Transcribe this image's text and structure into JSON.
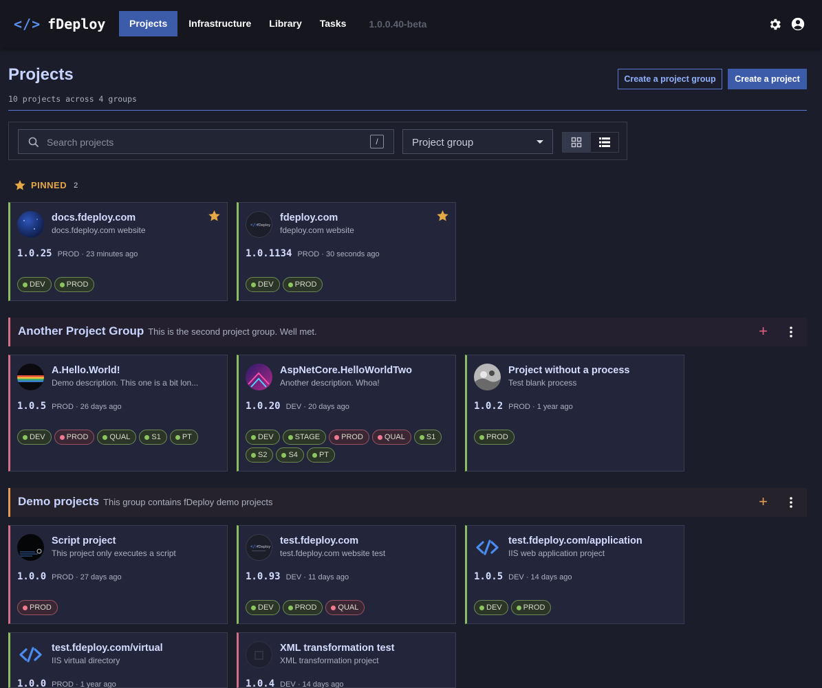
{
  "app": {
    "brand_code": "</>",
    "brand_name": "fDeploy",
    "version": "1.0.0.40-beta"
  },
  "nav": {
    "projects": "Projects",
    "infrastructure": "Infrastructure",
    "library": "Library",
    "tasks": "Tasks"
  },
  "header": {
    "title": "Projects",
    "subtitle": "10 projects across 4 groups",
    "create_group": "Create a project group",
    "create_project": "Create a project"
  },
  "filter": {
    "search_placeholder": "Search projects",
    "shortcut": "/",
    "group_select": "Project group"
  },
  "pinned": {
    "label": "PINNED",
    "count": "2"
  },
  "groups": [
    {
      "name": "Another Project Group",
      "description": "This is the second project group. Well met."
    },
    {
      "name": "Demo projects",
      "description": "This group contains fDeploy demo projects"
    }
  ],
  "colors": {
    "accent": "#3c5ba8",
    "success": "#8cc460",
    "danger": "#f07a92",
    "pinned": "#e6a845"
  },
  "cards": [
    {
      "title": "docs.fdeploy.com",
      "desc": "docs.fdeploy.com website",
      "version": "1.0.25",
      "meta": "PROD · 23 minutes ago",
      "tags": [
        "DEV",
        "PROD"
      ]
    },
    {
      "title": "fdeploy.com",
      "desc": "fdeploy.com website",
      "version": "1.0.1134",
      "meta": "PROD · 30 seconds ago",
      "tags": [
        "DEV",
        "PROD"
      ]
    },
    {
      "title": "A.Hello.World!",
      "desc": "Demo description. This one is a bit lon...",
      "version": "1.0.5",
      "meta": "PROD · 26 days ago",
      "tags": [
        "DEV",
        "PROD",
        "QUAL",
        "S1",
        "PT"
      ]
    },
    {
      "title": "AspNetCore.HelloWorldTwo",
      "desc": "Another description. Whoa!",
      "version": "1.0.20",
      "meta": "DEV · 20 days ago",
      "tags": [
        "DEV",
        "STAGE",
        "PROD",
        "QUAL",
        "S1",
        "S2",
        "S4",
        "PT"
      ]
    },
    {
      "title": "Project without a process",
      "desc": "Test blank process",
      "version": "1.0.2",
      "meta": "PROD · 1 year ago",
      "tags": [
        "PROD"
      ]
    },
    {
      "title": "Script project",
      "desc": "This project only executes a script",
      "version": "1.0.0",
      "meta": "PROD · 27 days ago",
      "tags": [
        "PROD"
      ]
    },
    {
      "title": "test.fdeploy.com",
      "desc": "test.fdeploy.com website test",
      "version": "1.0.93",
      "meta": "DEV · 11 days ago",
      "tags": [
        "DEV",
        "PROD",
        "QUAL"
      ]
    },
    {
      "title": "test.fdeploy.com/application",
      "desc": "IIS web application project",
      "version": "1.0.5",
      "meta": "DEV · 14 days ago",
      "tags": [
        "DEV",
        "PROD"
      ]
    },
    {
      "title": "test.fdeploy.com/virtual",
      "desc": "IIS virtual directory",
      "version": "1.0.0",
      "meta": "PROD · 1 year ago",
      "tags": []
    },
    {
      "title": "XML transformation test",
      "desc": "XML transformation project",
      "version": "1.0.4",
      "meta": "DEV · 14 days ago",
      "tags": []
    }
  ]
}
